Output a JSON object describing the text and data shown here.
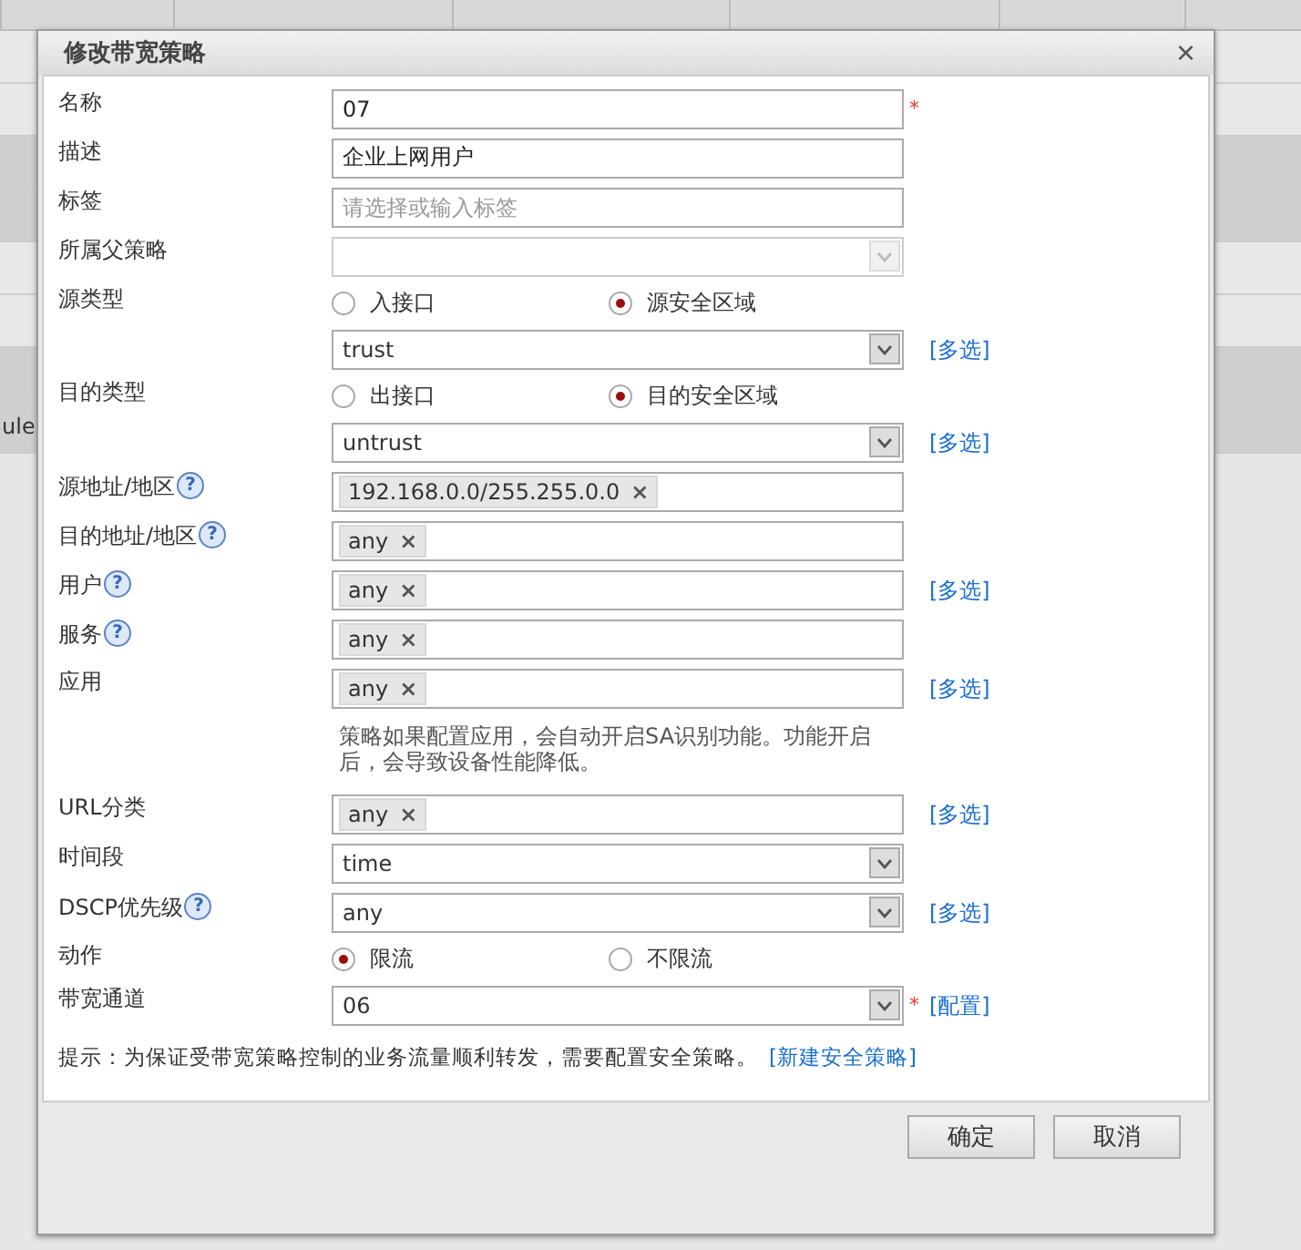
{
  "background": {
    "cells": [
      "",
      "",
      "",
      "",
      "",
      "",
      "",
      "ule"
    ]
  },
  "dialog": {
    "title": "修改带宽策略",
    "close": "×",
    "fields": [
      {
        "kind": "text",
        "label": "名称",
        "value": "07",
        "required": "*"
      },
      {
        "kind": "text",
        "label": "描述",
        "value": "企业上网用户"
      },
      {
        "kind": "text",
        "label": "标签",
        "placeholder": "请选择或输入标签"
      },
      {
        "kind": "select",
        "label": "所属父策略",
        "disabled": true
      },
      {
        "kind": "radio",
        "label": "源类型",
        "options": [
          {
            "label": "入接口",
            "selected": false
          },
          {
            "label": "源安全区域",
            "selected": true
          }
        ]
      },
      {
        "kind": "select",
        "value": "trust",
        "link": "[多选]",
        "disabled": false
      },
      {
        "kind": "radio",
        "label": "目的类型",
        "options": [
          {
            "label": "出接口",
            "selected": false
          },
          {
            "label": "目的安全区域",
            "selected": true
          }
        ]
      },
      {
        "kind": "select",
        "value": "untrust",
        "link": "[多选]",
        "disabled": false
      },
      {
        "kind": "tags",
        "label": "源地址/地区",
        "help": "?",
        "tags": [
          {
            "text": "192.168.0.0/255.255.0.0",
            "remove": "×"
          }
        ]
      },
      {
        "kind": "tags",
        "label": "目的地址/地区",
        "help": "?",
        "tags": [
          {
            "text": "any",
            "remove": "×"
          }
        ]
      },
      {
        "kind": "tags",
        "label": "用户",
        "help": "?",
        "tags": [
          {
            "text": "any",
            "remove": "×"
          }
        ],
        "link": "[多选]"
      },
      {
        "kind": "tags",
        "label": "服务",
        "help": "?",
        "tags": [
          {
            "text": "any",
            "remove": "×"
          }
        ]
      },
      {
        "kind": "tags",
        "label": "应用",
        "tags": [
          {
            "text": "any",
            "remove": "×"
          }
        ],
        "link": "[多选]"
      },
      {
        "kind": "note",
        "text": "策略如果配置应用，会自动开启SA识别功能。功能开启后，会导致设备性能降低。"
      },
      {
        "kind": "tags",
        "label": "URL分类",
        "tags": [
          {
            "text": "any",
            "remove": "×"
          }
        ],
        "link": "[多选]"
      },
      {
        "kind": "select",
        "label": "时间段",
        "value": "time",
        "disabled": false
      },
      {
        "kind": "select",
        "label": "DSCP优先级",
        "help": "?",
        "value": "any",
        "link": "[多选]",
        "disabled": false
      },
      {
        "kind": "radio",
        "label": "动作",
        "options": [
          {
            "label": "限流",
            "selected": true
          },
          {
            "label": "不限流",
            "selected": false
          }
        ]
      },
      {
        "kind": "select",
        "label": "带宽通道",
        "value": "06",
        "required": "*",
        "link": "[配置]",
        "disabled": false
      }
    ],
    "hint": {
      "text": "提示：为保证受带宽策略控制的业务流量顺利转发，需要配置安全策略。",
      "link": "[新建安全策略]"
    },
    "buttons": [
      "确定",
      "取消"
    ]
  }
}
